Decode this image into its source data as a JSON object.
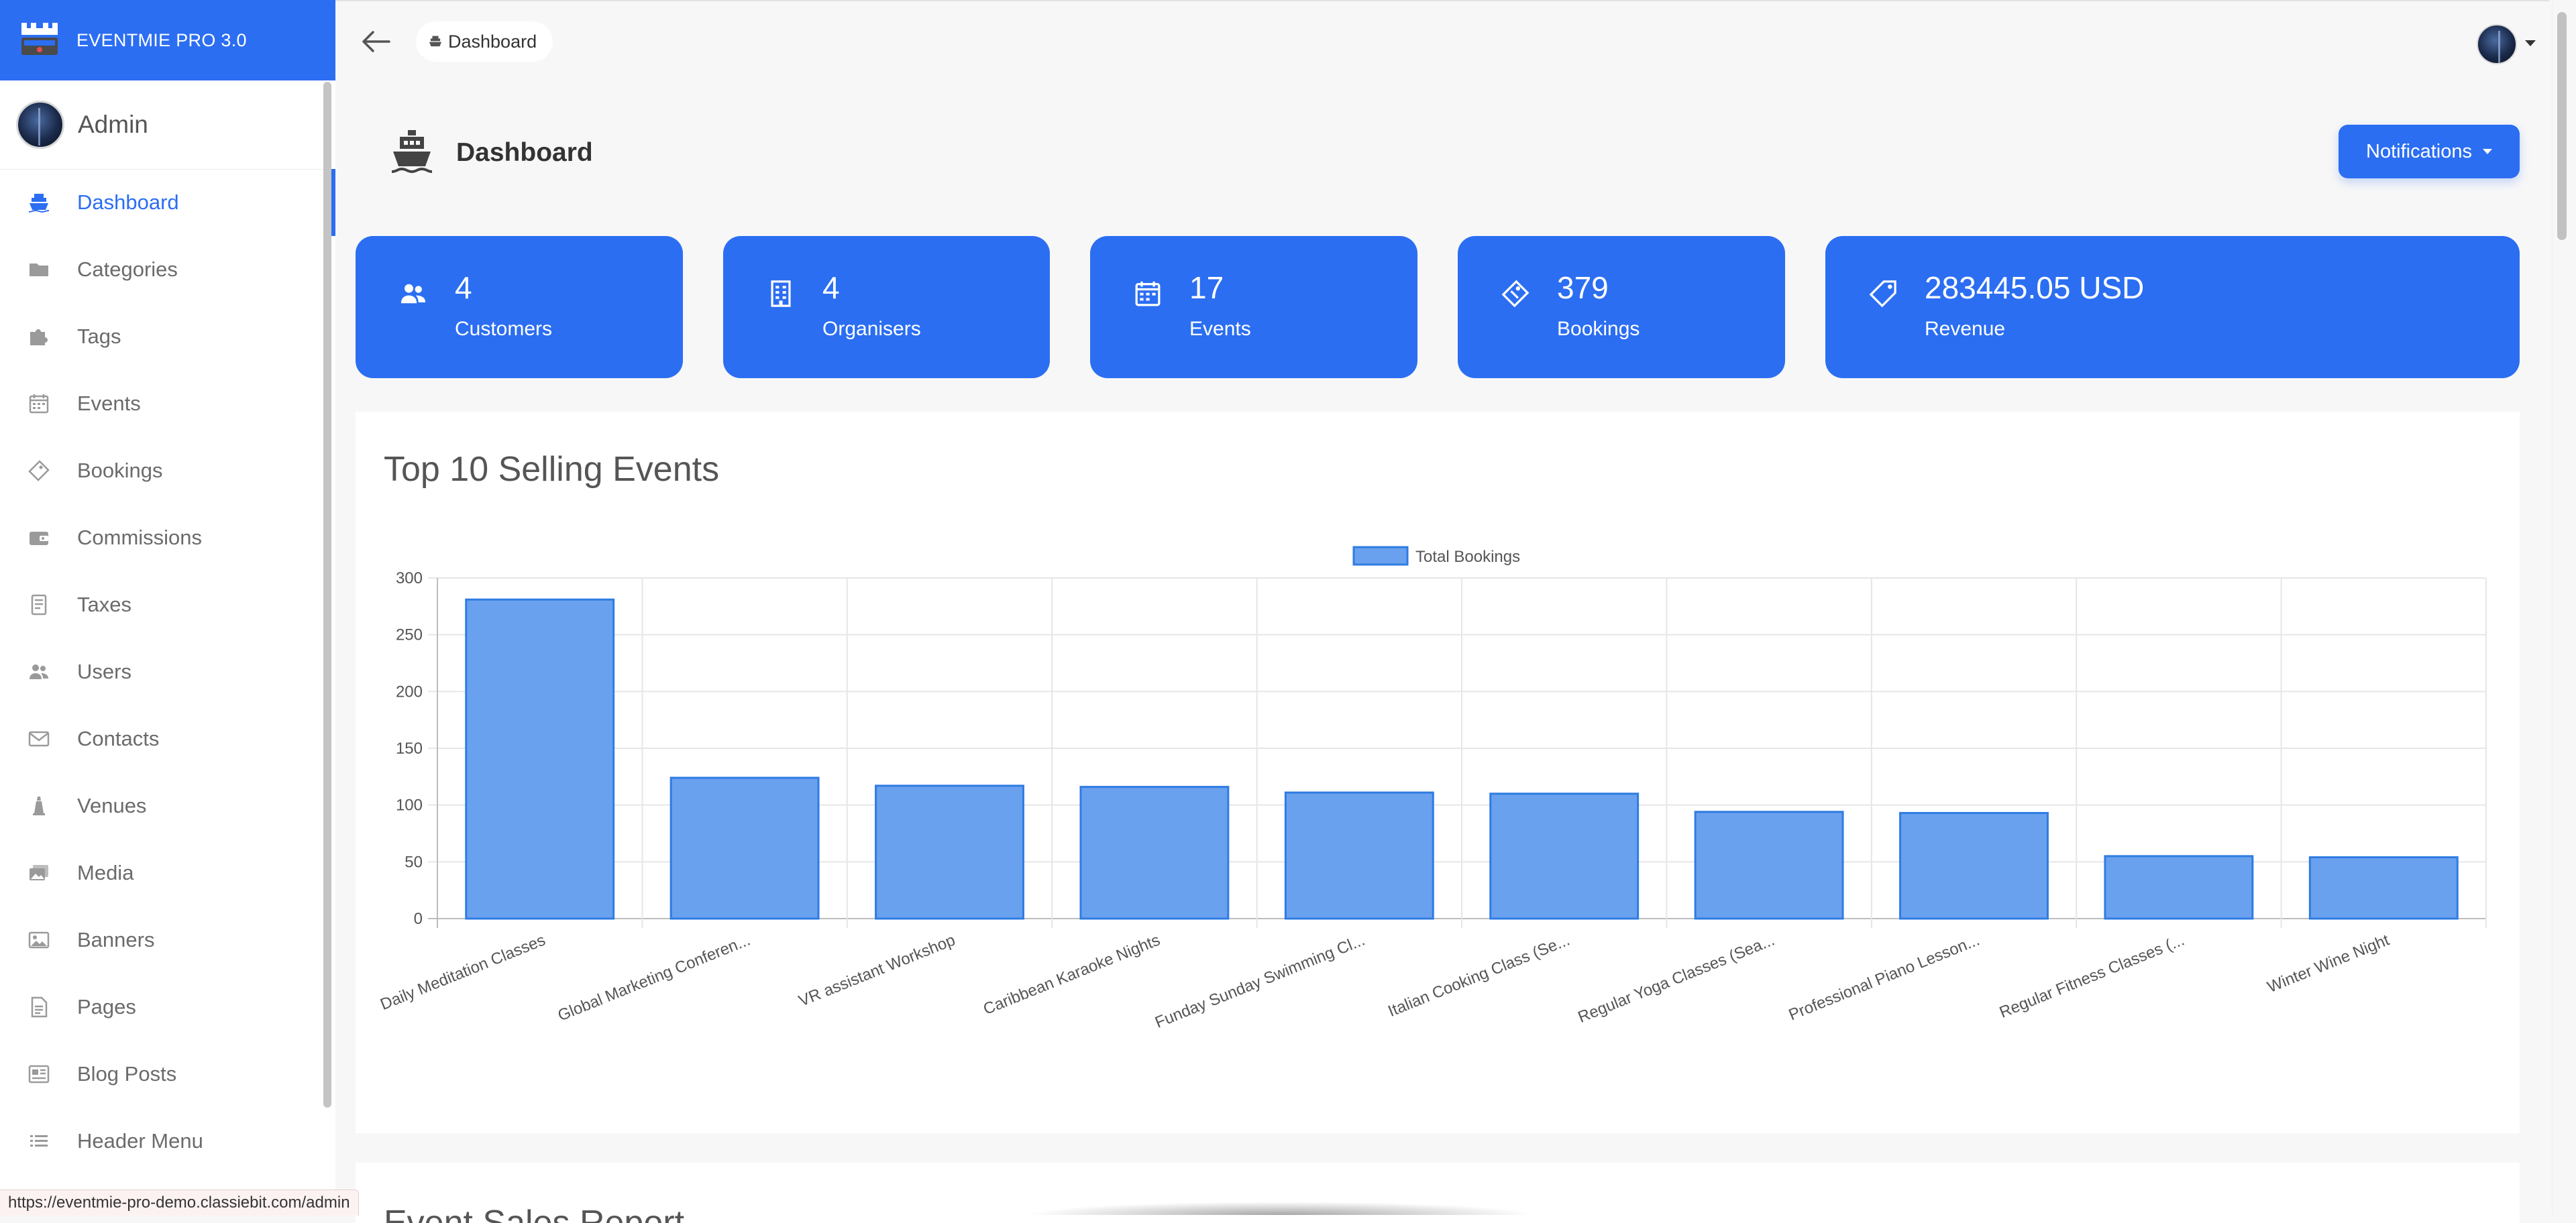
{
  "brand": {
    "name": "EVENTMIE PRO 3.0"
  },
  "admin": {
    "name": "Admin"
  },
  "sidebar": {
    "items": [
      {
        "label": "Dashboard",
        "icon": "ship-icon",
        "active": true
      },
      {
        "label": "Categories",
        "icon": "folder-icon"
      },
      {
        "label": "Tags",
        "icon": "puzzle-icon"
      },
      {
        "label": "Events",
        "icon": "calendar-icon"
      },
      {
        "label": "Bookings",
        "icon": "ticket-icon"
      },
      {
        "label": "Commissions",
        "icon": "wallet-icon"
      },
      {
        "label": "Taxes",
        "icon": "receipt-icon"
      },
      {
        "label": "Users",
        "icon": "users-icon"
      },
      {
        "label": "Contacts",
        "icon": "mail-icon"
      },
      {
        "label": "Venues",
        "icon": "tower-icon"
      },
      {
        "label": "Media",
        "icon": "images-icon"
      },
      {
        "label": "Banners",
        "icon": "image-icon"
      },
      {
        "label": "Pages",
        "icon": "document-icon"
      },
      {
        "label": "Blog Posts",
        "icon": "news-icon"
      },
      {
        "label": "Header Menu",
        "icon": "list-icon"
      }
    ]
  },
  "topbar": {
    "breadcrumb": "Dashboard"
  },
  "page": {
    "title": "Dashboard",
    "notifications_label": "Notifications"
  },
  "stats": [
    {
      "value": "4",
      "label": "Customers",
      "icon": "users-icon"
    },
    {
      "value": "4",
      "label": "Organisers",
      "icon": "building-icon"
    },
    {
      "value": "17",
      "label": "Events",
      "icon": "calendar-icon"
    },
    {
      "value": "379",
      "label": "Bookings",
      "icon": "ticket-icon"
    },
    {
      "value": "283445.05 USD",
      "label": "Revenue",
      "icon": "tag-icon"
    }
  ],
  "chart_panel": {
    "title": "Top 10 Selling Events"
  },
  "chart_data": {
    "type": "bar",
    "title": "",
    "xlabel": "",
    "ylabel": "",
    "ylim": [
      0,
      300
    ],
    "yticks": [
      0,
      50,
      100,
      150,
      200,
      250,
      300
    ],
    "grid": true,
    "legend": "top-center",
    "color": "#6aa1ee",
    "border_color": "#2f7ce3",
    "categories": [
      "Daily Meditation Classes",
      "Global Marketing Conferen...",
      "VR assistant Workshop",
      "Caribbean Karaoke Nights",
      "Funday Sunday Swimming Cl...",
      "Italian Cooking Class (Se...",
      "Regular Yoga Classes (Sea...",
      "Professional Piano Lesson...",
      "Regular Fitness Classes (...",
      "Winter Wine Night"
    ],
    "series": [
      {
        "name": "Total Bookings",
        "values": [
          281,
          124,
          117,
          116,
          111,
          110,
          94,
          93,
          55,
          54
        ]
      }
    ]
  },
  "next_panel": {
    "title": "Event Sales Report"
  },
  "status_bar": {
    "url": "https://eventmie-pro-demo.classiebit.com/admin"
  },
  "colors": {
    "primary": "#2b6ef2",
    "sidebar_bg": "#ffffff",
    "page_bg": "#f7f7f7"
  }
}
